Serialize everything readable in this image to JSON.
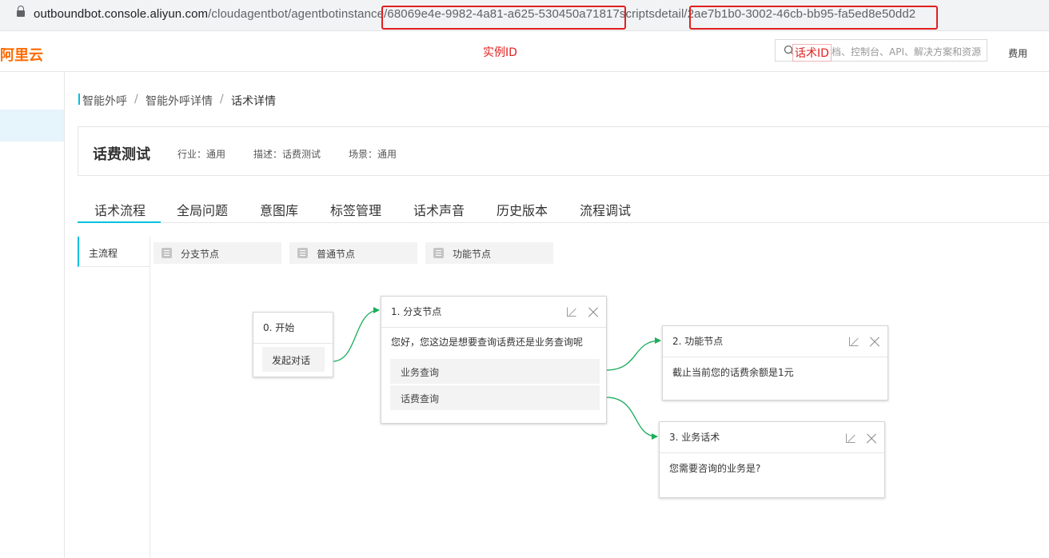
{
  "browser": {
    "url_host": "outboundbot.console.aliyun.com",
    "url_path1": "/cloudagentbot/agentbotinstance",
    "instance_id_segment": "/68069e4e-9982-4a81-a625-530450a71817",
    "url_path2": "scriptsdetail",
    "script_id_segment": "/2ae7b1b0-3002-46cb-bb95-fa5ed8e50dd2"
  },
  "topnav": {
    "logo": "阿里云",
    "annotation_instance": "实例ID",
    "annotation_script": "话术ID",
    "search_placeholder": "档、控制台、API、解决方案和资源",
    "fee": "费用"
  },
  "breadcrumb": [
    "智能外呼",
    "/",
    "智能外呼详情",
    "/",
    "话术详情"
  ],
  "header": {
    "title": "话费测试",
    "industry": "行业：通用",
    "description": "描述：话费测试",
    "scene": "场景：通用"
  },
  "tabs": [
    "话术流程",
    "全局问题",
    "意图库",
    "标签管理",
    "话术声音",
    "历史版本",
    "流程调试"
  ],
  "flow": {
    "main_flow": "主流程",
    "palette": [
      "分支节点",
      "普通节点",
      "功能节点"
    ],
    "nodes": {
      "start": {
        "title": "0. 开始",
        "button": "发起对话"
      },
      "branch": {
        "title": "1. 分支节点",
        "text": "您好，您这边是想要查询话费还是业务查询呢",
        "options": [
          "业务查询",
          "话费查询"
        ]
      },
      "func": {
        "title": "2. 功能节点",
        "text": "截止当前您的话费余额是1元"
      },
      "biz": {
        "title": "3. 业务话术",
        "text": "您需要咨询的业务是?"
      }
    }
  },
  "colors": {
    "accent": "#00c1de",
    "brand": "#ff6a00",
    "annotation": "#e02020",
    "edge": "#1aad5b"
  }
}
